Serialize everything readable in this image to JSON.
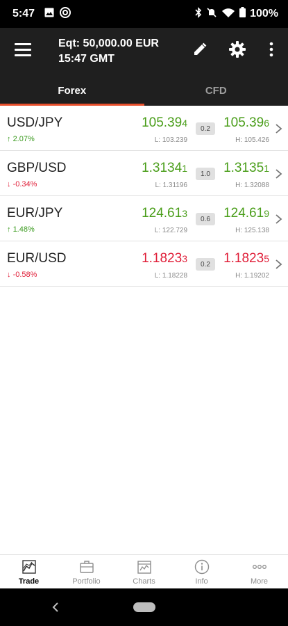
{
  "status_bar": {
    "time": "5:47",
    "battery": "100%"
  },
  "header": {
    "equity": "Eqt: 50,000.00 EUR",
    "time": "15:47 GMT"
  },
  "tabs": [
    {
      "label": "Forex",
      "active": true
    },
    {
      "label": "CFD",
      "active": false
    }
  ],
  "quotes": [
    {
      "pair": "USD/JPY",
      "change": "2.07%",
      "direction": "up",
      "bid_main": "105.39",
      "bid_pip": "4",
      "spread": "0.2",
      "ask_main": "105.39",
      "ask_pip": "6",
      "low": "L: 103.239",
      "high": "H: 105.426"
    },
    {
      "pair": "GBP/USD",
      "change": "-0.34%",
      "direction": "down",
      "bid_main": "1.3134",
      "bid_pip": "1",
      "spread": "1.0",
      "ask_main": "1.3135",
      "ask_pip": "1",
      "low": "L: 1.31196",
      "high": "H: 1.32088",
      "price_direction": "up"
    },
    {
      "pair": "EUR/JPY",
      "change": "1.48%",
      "direction": "up",
      "bid_main": "124.61",
      "bid_pip": "3",
      "spread": "0.6",
      "ask_main": "124.61",
      "ask_pip": "9",
      "low": "L: 122.729",
      "high": "H: 125.138"
    },
    {
      "pair": "EUR/USD",
      "change": "-0.58%",
      "direction": "down",
      "bid_main": "1.1823",
      "bid_pip": "3",
      "spread": "0.2",
      "ask_main": "1.1823",
      "ask_pip": "5",
      "low": "L: 1.18228",
      "high": "H: 1.19202"
    }
  ],
  "bottom_nav": [
    {
      "label": "Trade",
      "icon": "trade-chart-icon",
      "active": true
    },
    {
      "label": "Portfolio",
      "icon": "briefcase-icon",
      "active": false
    },
    {
      "label": "Charts",
      "icon": "calendar-chart-icon",
      "active": false
    },
    {
      "label": "Info",
      "icon": "info-icon",
      "active": false
    },
    {
      "label": "More",
      "icon": "more-dots-icon",
      "active": false
    }
  ],
  "colors": {
    "up": "#4a9e1a",
    "down": "#e0203a",
    "accent": "#e8502d",
    "header_bg": "#1f1f1f"
  }
}
